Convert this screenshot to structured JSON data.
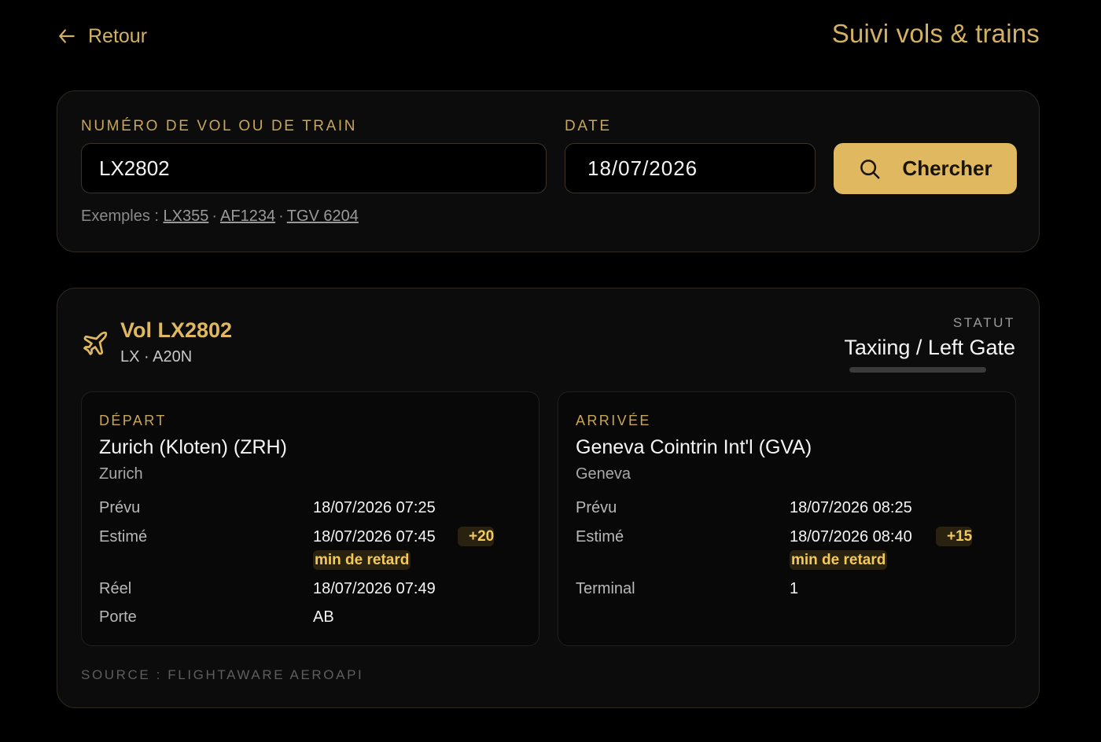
{
  "header": {
    "back_label": "Retour",
    "title": "Suivi vols & trains"
  },
  "search": {
    "number_label": "NUMÉRO DE VOL OU DE TRAIN",
    "number_value": "LX2802",
    "date_label": "DATE",
    "date_value": "18/07/2026",
    "button_label": "Chercher",
    "examples_prefix": "Exemples :",
    "examples": [
      "LX355",
      "AF1234",
      "TGV 6204"
    ],
    "separator": "·"
  },
  "result": {
    "title": "Vol LX2802",
    "subtitle": "LX · A20N",
    "status_label": "STATUT",
    "status_value": "Taxiing / Left Gate",
    "departure": {
      "kicker": "DÉPART",
      "airport": "Zurich (Kloten) (ZRH)",
      "city": "Zurich",
      "rows": [
        {
          "label": "Prévu",
          "value": "18/07/2026 07:25"
        },
        {
          "label": "Estimé",
          "value": "18/07/2026 07:45",
          "delay_amount": "+20",
          "delay_text": "min de retard"
        },
        {
          "label": "Réel",
          "value": "18/07/2026 07:49"
        },
        {
          "label": "Porte",
          "value": "AB"
        }
      ]
    },
    "arrival": {
      "kicker": "ARRIVÉE",
      "airport": "Geneva Cointrin Int'l (GVA)",
      "city": "Geneva",
      "rows": [
        {
          "label": "Prévu",
          "value": "18/07/2026 08:25"
        },
        {
          "label": "Estimé",
          "value": "18/07/2026 08:40",
          "delay_amount": "+15",
          "delay_text": "min de retard"
        },
        {
          "label": "Terminal",
          "value": "1"
        }
      ]
    },
    "source": "SOURCE : FLIGHTAWARE AEROAPI"
  },
  "icons": {
    "back": "arrow-left-icon",
    "search": "search-icon",
    "flight": "airplane-icon"
  },
  "colors": {
    "accent": "#dfb85f",
    "background": "#000000",
    "card": "#0c0c0c",
    "delay": "#f2c95a"
  }
}
